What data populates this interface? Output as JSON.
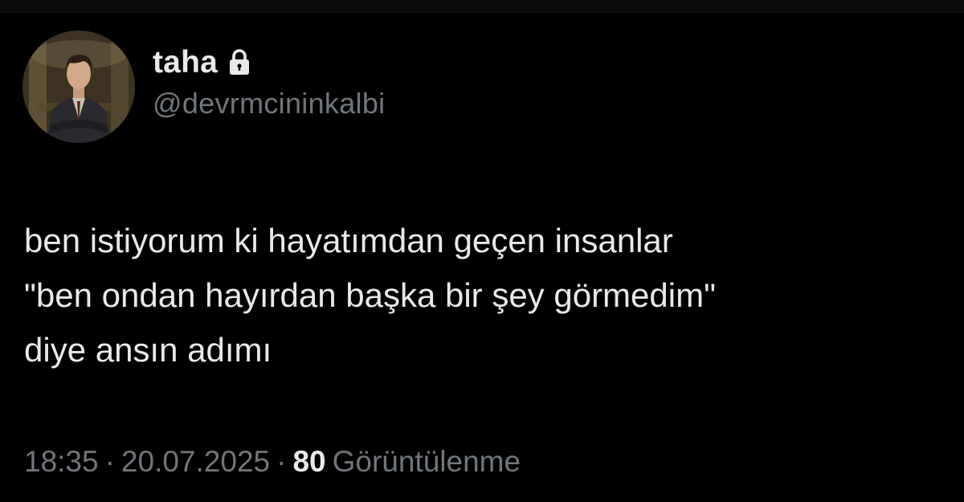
{
  "author": {
    "display_name": "taha",
    "handle": "@devrmcininkalbi",
    "protected_icon": "lock-icon",
    "avatar_icon": "profile-photo"
  },
  "tweet": {
    "text": "ben istiyorum ki hayatımdan geçen insanlar\n\"ben ondan hayırdan başka bir şey görmedim\"\ndiye ansın adımı"
  },
  "meta": {
    "time": "18:35",
    "separator": "·",
    "date": "20.07.2025",
    "views_count": "80",
    "views_label": "Görüntülenme"
  },
  "colors": {
    "background": "#000000",
    "primary_text": "#e7e9ea",
    "secondary_text": "#71767b"
  }
}
